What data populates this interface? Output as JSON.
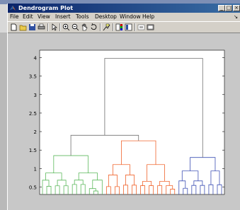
{
  "window": {
    "title": "Dendrogram Plot",
    "minimize_glyph": "_",
    "maximize_glyph": "□",
    "close_glyph": "×"
  },
  "menu": {
    "items": [
      "File",
      "Edit",
      "View",
      "Insert",
      "Tools",
      "Desktop",
      "Window",
      "Help"
    ],
    "overflow_glyph": "↘"
  },
  "toolbar": {
    "icons": [
      "new-figure-icon",
      "open-file-icon",
      "save-icon",
      "print-icon",
      "edit-plot-arrow-icon",
      "zoom-in-icon",
      "zoom-out-icon",
      "pan-hand-icon",
      "rotate-3d-icon",
      "data-cursor-icon",
      "colorbar-icon",
      "legend-icon",
      "hide-plot-tools-icon",
      "show-plot-tools-icon"
    ]
  },
  "colors": {
    "group1": "#5cb85c",
    "group2": "#f0642d",
    "group3": "#3f51b5",
    "top": "#707070"
  },
  "chart_data": {
    "type": "dendrogram",
    "title": "",
    "xlabel": "",
    "ylabel": "",
    "ylim": [
      0.3,
      4.2
    ],
    "yticks": [
      "0.5",
      "1",
      "1.5",
      "2",
      "2.5",
      "3",
      "3.5",
      "4"
    ],
    "grid": false,
    "clusters": [
      {
        "name": "",
        "color_key": "group1",
        "leaf_count": 15,
        "merge_height": 1.35
      },
      {
        "name": "",
        "color_key": "group2",
        "leaf_count": 17,
        "merge_height": 1.75
      },
      {
        "name": "",
        "color_key": "group3",
        "leaf_count": 11,
        "merge_height": 1.3
      }
    ],
    "top_merges": [
      {
        "joins": "group1+group2",
        "height": 1.9
      },
      {
        "joins": "all",
        "height": 3.98
      }
    ]
  }
}
